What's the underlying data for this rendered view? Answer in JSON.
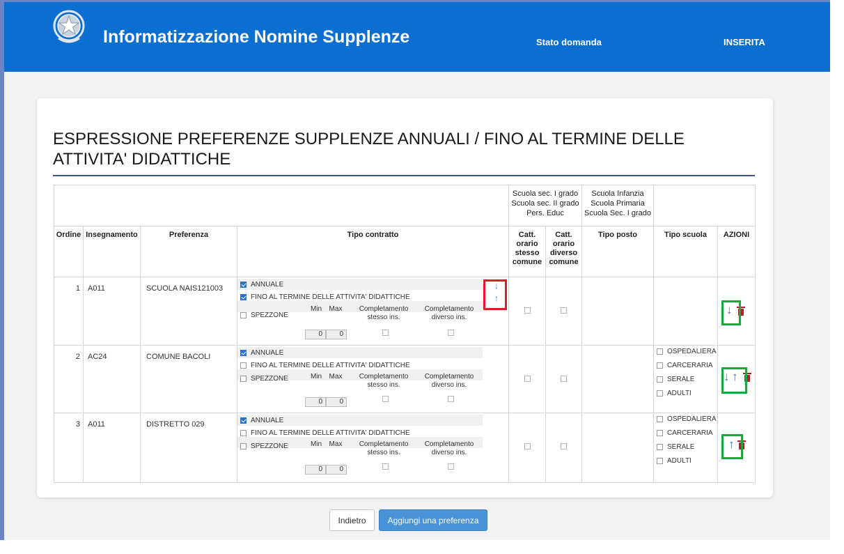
{
  "header": {
    "title": "Informatizzazione Nomine Supplenze",
    "stato_label": "Stato domanda",
    "stato_value": "INSERITA",
    "emblem_icon": "italian-republic-emblem",
    "background": "#0b6ed1"
  },
  "page": {
    "title": "ESPRESSIONE PREFERENZE SUPPLENZE ANNUALI / FINO AL TERMINE DELLE ATTIVITA' DIDATTICHE"
  },
  "table": {
    "group_headers": {
      "sec": [
        "Scuola sec. I grado",
        "Scuola sec. II grado",
        "Pers. Educ"
      ],
      "inf": [
        "Scuola Infanzia",
        "Scuola Primaria",
        "Scuola Sec. I grado"
      ]
    },
    "columns": {
      "ordine": "Ordine",
      "insegnamento": "Insegnamento",
      "preferenza": "Preferenza",
      "tipo_contratto": "Tipo contratto",
      "catt_stesso": [
        "Catt.",
        "orario",
        "stesso",
        "comune"
      ],
      "catt_diverso": [
        "Catt.",
        "orario",
        "diverso",
        "comune"
      ],
      "tipo_posto": "Tipo posto",
      "tipo_scuola": "Tipo scuola",
      "azioni": "AZIONI"
    },
    "contract_labels": {
      "annuale": "ANNUALE",
      "fino": "FINO AL TERMINE DELLE ATTIVITA' DIDATTICHE",
      "spezzone": "SPEZZONE",
      "min": "Min",
      "max": "Max",
      "compl_stesso": [
        "Completamento",
        "stesso ins."
      ],
      "compl_diverso": [
        "Completamento",
        "diverso ins."
      ]
    },
    "school_types": [
      "OSPEDALIERA",
      "CARCERARIA",
      "SERALE",
      "ADULTI"
    ],
    "rows": [
      {
        "ordine": "1",
        "insegnamento": "A011",
        "preferenza": "SCUOLA NAIS121003",
        "annuale": true,
        "fino": true,
        "spezzone": false,
        "min": "0",
        "max": "0",
        "order_arrows": [
          "↓",
          "↑"
        ],
        "actions": [
          "arrow-down-icon"
        ],
        "show_school_types": false
      },
      {
        "ordine": "2",
        "insegnamento": "AC24",
        "preferenza": "COMUNE BACOLI",
        "annuale": true,
        "fino": false,
        "spezzone": false,
        "min": "0",
        "max": "0",
        "actions": [
          "arrow-down-icon",
          "arrow-up-icon"
        ],
        "show_school_types": true
      },
      {
        "ordine": "3",
        "insegnamento": "A011",
        "preferenza": "DISTRETTO 029",
        "annuale": true,
        "fino": false,
        "spezzone": false,
        "min": "0",
        "max": "0",
        "actions": [
          "arrow-up-icon"
        ],
        "show_school_types": true
      }
    ],
    "arrow_down": "↓",
    "arrow_up": "↑"
  },
  "buttons": {
    "back": "Indietro",
    "add": "Aggiungi una preferenza"
  },
  "colors": {
    "accent": "#0b6ed1",
    "primary_button": "#4a92d6",
    "highlight_red": "#e01b24",
    "highlight_green": "#21a53d",
    "delete": "#b0202a"
  }
}
